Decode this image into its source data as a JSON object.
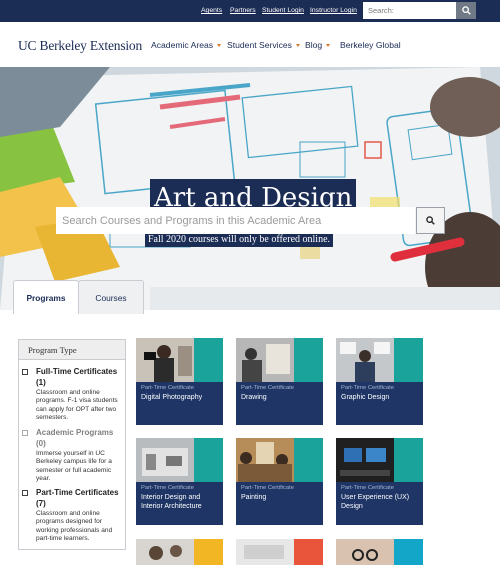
{
  "topbar": {
    "links": [
      "Agents",
      "Partners",
      "Student Login",
      "Instructor Login"
    ],
    "search_placeholder": "Search:"
  },
  "nav": {
    "logo": "UC Berkeley Extension",
    "items": [
      {
        "label": "Academic Areas",
        "dropdown": true
      },
      {
        "label": "Student Services",
        "dropdown": true
      },
      {
        "label": "Blog",
        "dropdown": true
      },
      {
        "label": "Berkeley Global",
        "dropdown": false
      }
    ],
    "caret_color": "#d97a2b"
  },
  "hero": {
    "title": "Art and Design",
    "subtitle": "Fall 2020 courses will only be offered online.",
    "search_placeholder": "Search Courses and Programs in this Academic Area"
  },
  "tabs": [
    {
      "label": "Programs",
      "active": true
    },
    {
      "label": "Courses",
      "active": false
    }
  ],
  "filter": {
    "heading": "Program Type",
    "options": [
      {
        "title": "Full-Time Certificates (1)",
        "desc": "Classroom and online programs. F-1 visa students can apply for OPT after two semesters.",
        "disabled": false
      },
      {
        "title": "Academic Programs (0)",
        "desc": "Immerse yourself in UC Berkeley campus life for a semester or full academic year.",
        "disabled": true
      },
      {
        "title": "Part-Time Certificates (7)",
        "desc": "Classroom and online programs designed for working professionals and part-time learners.",
        "disabled": false
      }
    ]
  },
  "cards": [
    {
      "type": "Part-Time Certificate",
      "title": "Digital Photography",
      "accent": "#1aa39a"
    },
    {
      "type": "Part-Time Certificate",
      "title": "Drawing",
      "accent": "#1aa39a"
    },
    {
      "type": "Part-Time Certificate",
      "title": "Graphic Design",
      "accent": "#1aa39a"
    },
    {
      "type": "Part-Time Certificate",
      "title": "Interior Design and Interior Architecture",
      "accent": "#1aa39a"
    },
    {
      "type": "Part-Time Certificate",
      "title": "Painting",
      "accent": "#1aa39a"
    },
    {
      "type": "Part-Time Certificate",
      "title": "User Experience (UX) Design",
      "accent": "#1aa39a"
    }
  ],
  "partial_accents": [
    "#f2b523",
    "#e9553a",
    "#14a6c9"
  ],
  "colors": {
    "brand_navy": "#1b2c55",
    "card_navy": "#1e3566"
  },
  "icons": {
    "search": "magnifier-icon"
  }
}
